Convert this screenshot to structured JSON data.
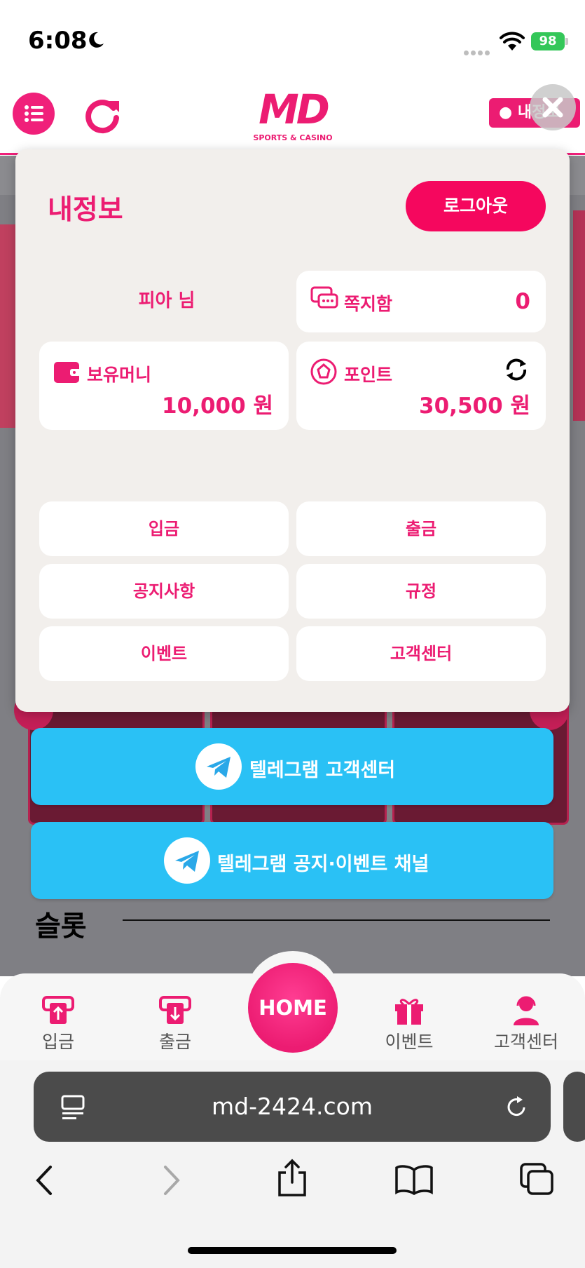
{
  "status_bar": {
    "time": "6:08",
    "battery": "98"
  },
  "header": {
    "logo_text": "MD",
    "logo_subtitle": "SPORTS & CASINO",
    "my_info_label": "내정보",
    "accent_color": "#ec1c72"
  },
  "modal": {
    "title": "내정보",
    "logout_label": "로그아웃",
    "user_name": "피아 님",
    "messages": {
      "label": "쪽지함",
      "count": "0"
    },
    "balance": {
      "label": "보유머니",
      "value": "10,000 원"
    },
    "points": {
      "label": "포인트",
      "value": "30,500 원"
    },
    "menu": {
      "deposit": "입금",
      "withdraw": "출금",
      "notice": "공지사항",
      "rules": "규정",
      "event": "이벤트",
      "support": "고객센터"
    }
  },
  "telegram": {
    "support_label": "텔레그램 고객센터",
    "channel_label": "텔레그램 공지·이벤트 채널",
    "color": "#2ac1f5"
  },
  "section": {
    "slot_title": "슬롯"
  },
  "bottom_nav": {
    "deposit": "입금",
    "withdraw": "출금",
    "home": "HOME",
    "event": "이벤트",
    "support": "고객센터"
  },
  "browser": {
    "url": "md-2424.com"
  }
}
